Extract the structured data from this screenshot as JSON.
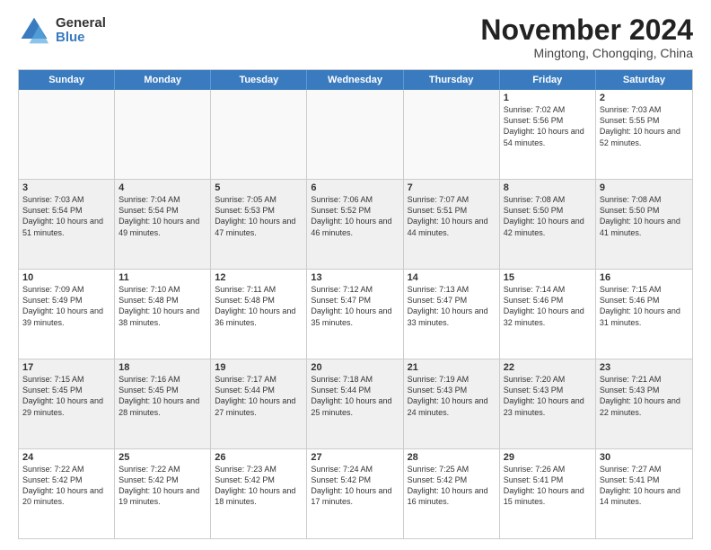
{
  "logo": {
    "general": "General",
    "blue": "Blue"
  },
  "header": {
    "month": "November 2024",
    "location": "Mingtong, Chongqing, China"
  },
  "weekdays": [
    "Sunday",
    "Monday",
    "Tuesday",
    "Wednesday",
    "Thursday",
    "Friday",
    "Saturday"
  ],
  "rows": [
    [
      {
        "day": "",
        "info": "",
        "empty": true
      },
      {
        "day": "",
        "info": "",
        "empty": true
      },
      {
        "day": "",
        "info": "",
        "empty": true
      },
      {
        "day": "",
        "info": "",
        "empty": true
      },
      {
        "day": "",
        "info": "",
        "empty": true
      },
      {
        "day": "1",
        "info": "Sunrise: 7:02 AM\nSunset: 5:56 PM\nDaylight: 10 hours and 54 minutes."
      },
      {
        "day": "2",
        "info": "Sunrise: 7:03 AM\nSunset: 5:55 PM\nDaylight: 10 hours and 52 minutes."
      }
    ],
    [
      {
        "day": "3",
        "info": "Sunrise: 7:03 AM\nSunset: 5:54 PM\nDaylight: 10 hours and 51 minutes."
      },
      {
        "day": "4",
        "info": "Sunrise: 7:04 AM\nSunset: 5:54 PM\nDaylight: 10 hours and 49 minutes."
      },
      {
        "day": "5",
        "info": "Sunrise: 7:05 AM\nSunset: 5:53 PM\nDaylight: 10 hours and 47 minutes."
      },
      {
        "day": "6",
        "info": "Sunrise: 7:06 AM\nSunset: 5:52 PM\nDaylight: 10 hours and 46 minutes."
      },
      {
        "day": "7",
        "info": "Sunrise: 7:07 AM\nSunset: 5:51 PM\nDaylight: 10 hours and 44 minutes."
      },
      {
        "day": "8",
        "info": "Sunrise: 7:08 AM\nSunset: 5:50 PM\nDaylight: 10 hours and 42 minutes."
      },
      {
        "day": "9",
        "info": "Sunrise: 7:08 AM\nSunset: 5:50 PM\nDaylight: 10 hours and 41 minutes."
      }
    ],
    [
      {
        "day": "10",
        "info": "Sunrise: 7:09 AM\nSunset: 5:49 PM\nDaylight: 10 hours and 39 minutes."
      },
      {
        "day": "11",
        "info": "Sunrise: 7:10 AM\nSunset: 5:48 PM\nDaylight: 10 hours and 38 minutes."
      },
      {
        "day": "12",
        "info": "Sunrise: 7:11 AM\nSunset: 5:48 PM\nDaylight: 10 hours and 36 minutes."
      },
      {
        "day": "13",
        "info": "Sunrise: 7:12 AM\nSunset: 5:47 PM\nDaylight: 10 hours and 35 minutes."
      },
      {
        "day": "14",
        "info": "Sunrise: 7:13 AM\nSunset: 5:47 PM\nDaylight: 10 hours and 33 minutes."
      },
      {
        "day": "15",
        "info": "Sunrise: 7:14 AM\nSunset: 5:46 PM\nDaylight: 10 hours and 32 minutes."
      },
      {
        "day": "16",
        "info": "Sunrise: 7:15 AM\nSunset: 5:46 PM\nDaylight: 10 hours and 31 minutes."
      }
    ],
    [
      {
        "day": "17",
        "info": "Sunrise: 7:15 AM\nSunset: 5:45 PM\nDaylight: 10 hours and 29 minutes."
      },
      {
        "day": "18",
        "info": "Sunrise: 7:16 AM\nSunset: 5:45 PM\nDaylight: 10 hours and 28 minutes."
      },
      {
        "day": "19",
        "info": "Sunrise: 7:17 AM\nSunset: 5:44 PM\nDaylight: 10 hours and 27 minutes."
      },
      {
        "day": "20",
        "info": "Sunrise: 7:18 AM\nSunset: 5:44 PM\nDaylight: 10 hours and 25 minutes."
      },
      {
        "day": "21",
        "info": "Sunrise: 7:19 AM\nSunset: 5:43 PM\nDaylight: 10 hours and 24 minutes."
      },
      {
        "day": "22",
        "info": "Sunrise: 7:20 AM\nSunset: 5:43 PM\nDaylight: 10 hours and 23 minutes."
      },
      {
        "day": "23",
        "info": "Sunrise: 7:21 AM\nSunset: 5:43 PM\nDaylight: 10 hours and 22 minutes."
      }
    ],
    [
      {
        "day": "24",
        "info": "Sunrise: 7:22 AM\nSunset: 5:42 PM\nDaylight: 10 hours and 20 minutes."
      },
      {
        "day": "25",
        "info": "Sunrise: 7:22 AM\nSunset: 5:42 PM\nDaylight: 10 hours and 19 minutes."
      },
      {
        "day": "26",
        "info": "Sunrise: 7:23 AM\nSunset: 5:42 PM\nDaylight: 10 hours and 18 minutes."
      },
      {
        "day": "27",
        "info": "Sunrise: 7:24 AM\nSunset: 5:42 PM\nDaylight: 10 hours and 17 minutes."
      },
      {
        "day": "28",
        "info": "Sunrise: 7:25 AM\nSunset: 5:42 PM\nDaylight: 10 hours and 16 minutes."
      },
      {
        "day": "29",
        "info": "Sunrise: 7:26 AM\nSunset: 5:41 PM\nDaylight: 10 hours and 15 minutes."
      },
      {
        "day": "30",
        "info": "Sunrise: 7:27 AM\nSunset: 5:41 PM\nDaylight: 10 hours and 14 minutes."
      }
    ]
  ]
}
